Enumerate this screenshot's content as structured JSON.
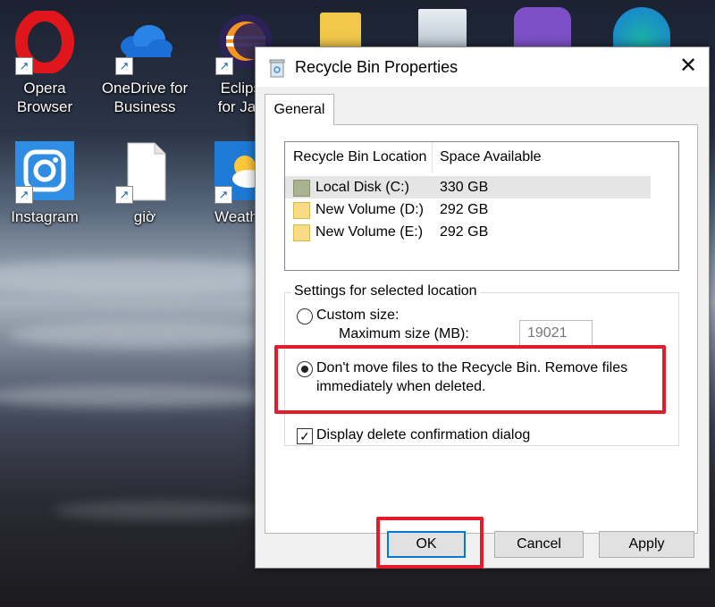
{
  "desktop": {
    "icons": [
      {
        "label1": "Opera",
        "label2": "Browser",
        "icon": "opera-icon"
      },
      {
        "label1": "OneDrive for",
        "label2": "Business",
        "icon": "onedrive-icon"
      },
      {
        "label1": "Eclipse",
        "label2": "for Java",
        "icon": "eclipse-icon"
      },
      {
        "label1": "Instagram",
        "label2": "",
        "icon": "instagram-icon"
      },
      {
        "label1": "giờ",
        "label2": "",
        "icon": "file-icon"
      },
      {
        "label1": "Weath",
        "label2": "",
        "icon": "weather-icon"
      }
    ]
  },
  "dialog": {
    "title": "Recycle Bin Properties",
    "close": "✕",
    "tab": "General",
    "list": {
      "headers": [
        "Recycle Bin Location",
        "Space Available"
      ],
      "rows": [
        {
          "name": "Local Disk (C:)",
          "space": "330 GB",
          "selected": true
        },
        {
          "name": "New Volume (D:)",
          "space": "292 GB",
          "selected": false
        },
        {
          "name": "New Volume (E:)",
          "space": "292 GB",
          "selected": false
        }
      ]
    },
    "settings": {
      "group_label": "Settings for selected location",
      "custom_size": "Custom size:",
      "max_size_label": "Maximum size (MB):",
      "max_size_value": "19021",
      "dont_move_line1": "Don't move files to the Recycle Bin. Remove files",
      "dont_move_line2": "immediately when deleted.",
      "confirm_dialog": "Display delete confirmation dialog",
      "confirm_checked": true
    },
    "buttons": {
      "ok": "OK",
      "cancel": "Cancel",
      "apply": "Apply"
    }
  },
  "colors": {
    "highlight": "#e21b2d",
    "accent": "#0078d7"
  }
}
